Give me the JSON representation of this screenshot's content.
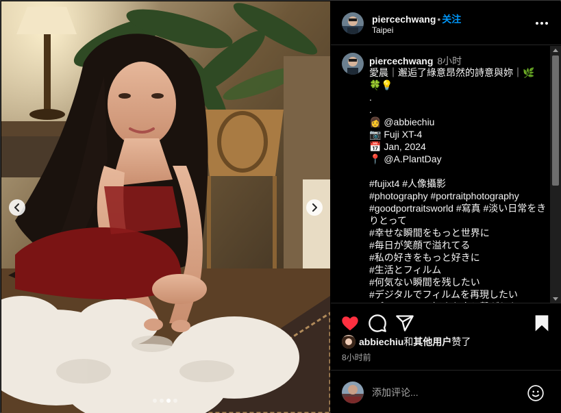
{
  "post": {
    "username": "piercechwang",
    "separator": "•",
    "follow_label": "关注",
    "location": "Taipei"
  },
  "caption": {
    "username": "piercechwang",
    "time": "8小时",
    "text": "愛晨｜邂逅了綠意昂然的詩意與妳｜🌿\n🍀💡\n.\n.\n👩 @abbiechiu\n📷 Fuji XT-4\n📅 Jan, 2024\n📍 @A.PlantDay\n\n#fujixt4 #人像攝影\n#photography #portraitphotography\n#goodportraitsworld #寫真 #淡い日常をきりとって\n#幸せな瞬間をもっと世界に\n#毎日が笑顔で溢れてる\n#私の好きをもっと好きに\n#生活とフィルム\n#何気ない瞬間を残したい\n#デジタルでフィルムを再現したい\n#ポートレート好きな人と繋がりたい"
  },
  "likes": {
    "user": "abbiechiu",
    "conj": "和",
    "others": "其他用户",
    "suffix": "赞了"
  },
  "post_time": "8小时前",
  "comment": {
    "placeholder": "添加评论..."
  },
  "carousel": {
    "count": 4,
    "active_index": 2
  },
  "icons": {
    "prev": "chevron-left-icon",
    "next": "chevron-right-icon",
    "more": "more-horizontal-icon",
    "like": "heart-filled-icon",
    "comment": "comment-bubble-icon",
    "share": "paper-plane-icon",
    "save": "bookmark-filled-icon",
    "emoji": "smiley-icon"
  },
  "colors": {
    "like_red": "#ff3040",
    "follow_blue": "#0095f6",
    "muted_text": "#a8a8a8"
  }
}
